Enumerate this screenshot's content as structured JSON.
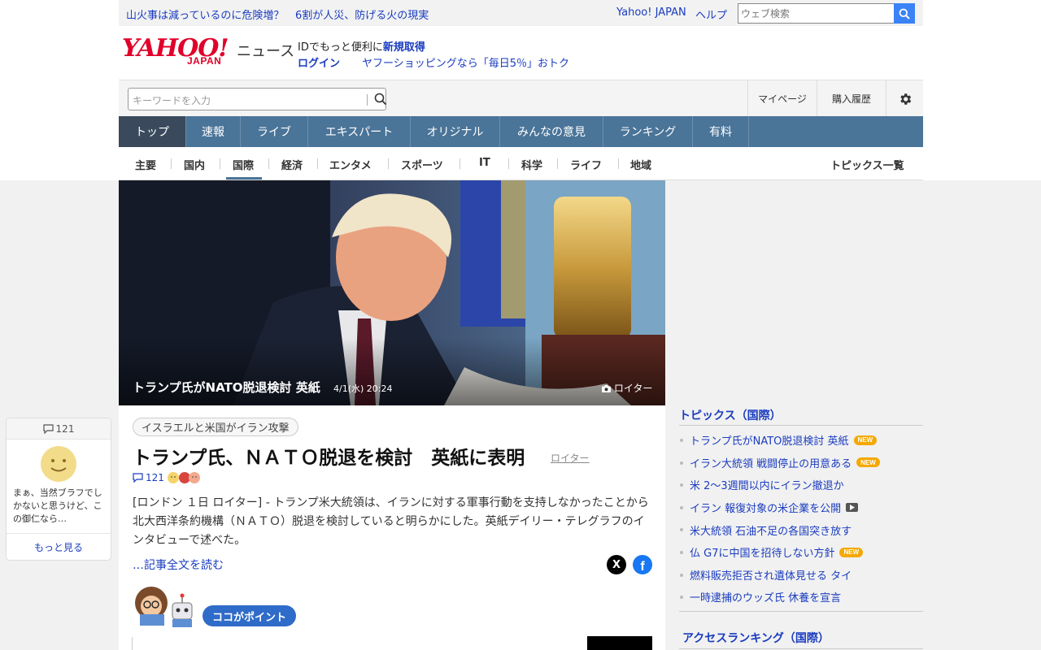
{
  "promo": {
    "link1": "山火事は減っているのに危険増？",
    "link2": "6割が人災、防げる火の現実"
  },
  "topbar": {
    "yahoo_japan": "Yahoo! JAPAN",
    "help": "ヘルプ",
    "web_search_placeholder": "ウェブ検索"
  },
  "header": {
    "logo_main": "YAHOO!",
    "logo_sub": "JAPAN",
    "section_name": "ニュース",
    "id_text": "IDでもっと便利に",
    "signup": "新規取得",
    "login": "ログイン",
    "shopping": "ヤフーショッピングなら「毎日5％」おトク"
  },
  "search": {
    "placeholder": "キーワードを入力",
    "mypage": "マイページ",
    "purchase_history": "購入履歴"
  },
  "nav": [
    {
      "label": "トップ",
      "active": true
    },
    {
      "label": "速報"
    },
    {
      "label": "ライブ"
    },
    {
      "label": "エキスパート"
    },
    {
      "label": "オリジナル"
    },
    {
      "label": "みんなの意見"
    },
    {
      "label": "ランキング"
    },
    {
      "label": "有料"
    }
  ],
  "subnav": [
    "主要",
    "国内",
    "国際",
    "経済",
    "エンタメ",
    "スポーツ",
    "IT",
    "科学",
    "ライフ",
    "地域"
  ],
  "subnav_active": "国際",
  "topics_all": "トピックス一覧",
  "article": {
    "hero_caption": "トランプ氏がNATO脱退検討 英紙",
    "hero_date": "4/1(水) 20:24",
    "hero_credit": "ロイター",
    "tag": "イスラエルと米国がイラン攻撃",
    "headline": "トランプ氏、ＮＡＴＯ脱退を検討　英紙に表明",
    "source": "ロイター",
    "comment_count": "121",
    "body": "[ロンドン １日 ロイター] - トランプ米大統領は、イランに対する軍事行動を支持しなかったことから北大西洋条約機構（ＮＡＴＯ）脱退を検討していると明らかにした。英紙デイリー・テレグラフのインタビューで述べた。",
    "read_more": "…記事全文を読む",
    "share_x": "X",
    "share_fb": "f",
    "point_label": "ココがポイント"
  },
  "comment_card": {
    "count": "121",
    "text": "まぁ、当然ブラフでしかないと思うけど、この御仁なら…",
    "more": "もっと見る"
  },
  "sidebar": {
    "topics_title": "トピックス（国際）",
    "topics": [
      {
        "text": "トランプ氏がNATO脱退検討 英紙",
        "badge": "NEW"
      },
      {
        "text": "イラン大統領 戦闘停止の用意ある",
        "badge": "NEW"
      },
      {
        "text": "米 2～3週間以内にイラン撤退か"
      },
      {
        "text": "イラン 報復対象の米企業を公開",
        "video": true
      },
      {
        "text": "米大統領 石油不足の各国突き放す"
      },
      {
        "text": "仏 G7に中国を招待しない方針",
        "badge": "NEW"
      },
      {
        "text": "燃料販売拒否され遺体見せる タイ"
      },
      {
        "text": "一時逮捕のウッズ氏 休養を宣言"
      }
    ],
    "ranking_title": "アクセスランキング（国際）"
  },
  "colors": {
    "nav_bg": "#4a7498",
    "nav_active": "#3a4a5c",
    "link": "#1a3cbf",
    "logo_red": "#e0002a",
    "new_badge": "#f5a800"
  }
}
